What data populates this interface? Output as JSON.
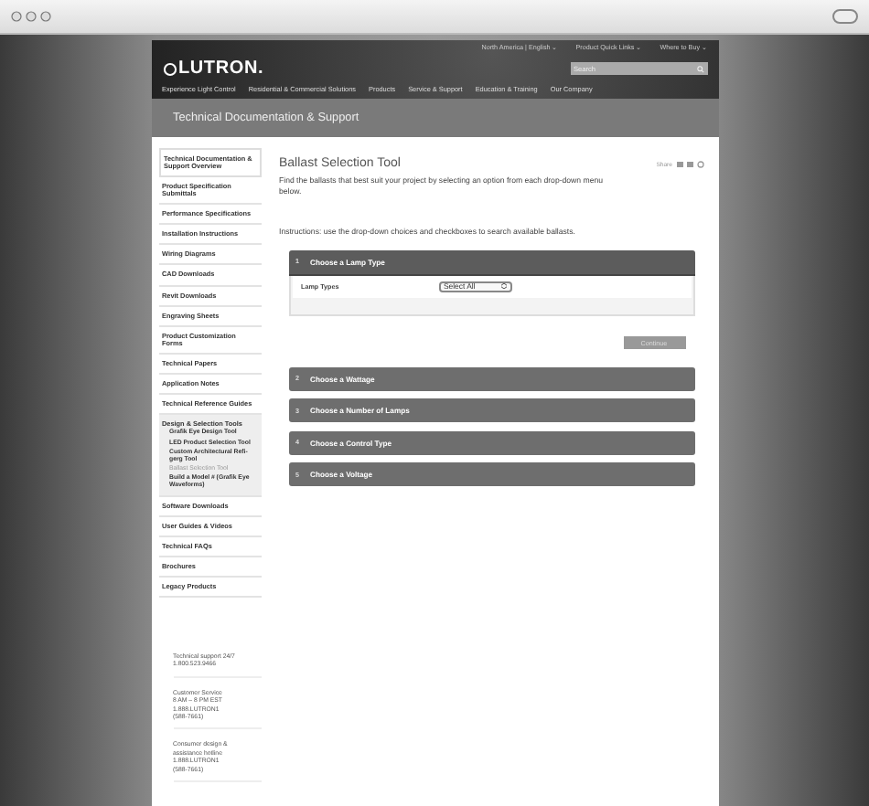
{
  "top_links": [
    "North America | English ⌄",
    "Product Quick Links ⌄",
    "Where to Buy ⌄"
  ],
  "logo": "LUTRON.",
  "search": {
    "placeholder": "Search"
  },
  "nav": [
    "Experience Light Control",
    "Residential & Commercial Solutions",
    "Products",
    "Service & Support",
    "Education & Training",
    "Our Company"
  ],
  "page_title": "Technical Documentation & Support",
  "sidebar": {
    "items": [
      {
        "label": "Technical Documentation & Support Overview"
      },
      {
        "label": "Product Specification Submittals"
      },
      {
        "label": "Performance Specifications"
      },
      {
        "label": "Installation Instructions"
      },
      {
        "label": "Wiring Diagrams"
      },
      {
        "label": "CAD Downloads"
      },
      {
        "label": "Revit Downloads"
      },
      {
        "label": "Engraving Sheets"
      },
      {
        "label": "Product Customization Forms"
      },
      {
        "label": "Technical Papers"
      },
      {
        "label": "Application Notes"
      },
      {
        "label": "Technical Reference Guides"
      },
      {
        "label": "Design & Selection Tools",
        "children": [
          {
            "label": "Grafik Eye Design Tool",
            "selected": false
          },
          {
            "label": "LED Product Selection Tool",
            "selected": false
          },
          {
            "label": "Custom Architectural Refi-gerg Tool",
            "selected": false
          },
          {
            "label": "Ballast Selection Tool",
            "selected": true
          },
          {
            "label": "Build a Model # (Grafik Eye Waveforms)",
            "selected": false
          }
        ]
      },
      {
        "label": "Software Downloads"
      },
      {
        "label": "User Guides & Videos"
      },
      {
        "label": "Technical FAQs"
      },
      {
        "label": "Brochures"
      },
      {
        "label": "Legacy Products"
      }
    ],
    "contacts": [
      [
        "Technical support 24/7",
        "1.800.523.9466"
      ],
      [
        "Customer Service",
        "8 AM – 8 PM EST",
        "1.888.LUTRON1",
        "(588-7661)"
      ],
      [
        "Consumer design &",
        "assistance hotline",
        "1.888.LUTRON1",
        "(588-7661)"
      ]
    ]
  },
  "main": {
    "title": "Ballast Selection Tool",
    "share": "Share",
    "description": "Find the ballasts that best suit your project by selecting an option from each drop-down menu below.",
    "instructions": "Instructions: use the drop-down choices and checkboxes to search available ballasts.",
    "steps": [
      {
        "number": "1",
        "title": "Choose a Lamp Type",
        "expanded": true,
        "field_label": "Lamp Types",
        "select_value": "Select All",
        "button": "Continue"
      },
      {
        "number": "2",
        "title": "Choose a Wattage",
        "expanded": false
      },
      {
        "number": "3",
        "title": "Choose a Number of Lamps",
        "expanded": false
      },
      {
        "number": "4",
        "title": "Choose a Control Type",
        "expanded": false
      },
      {
        "number": "5",
        "title": "Choose a Voltage",
        "expanded": false
      }
    ]
  }
}
